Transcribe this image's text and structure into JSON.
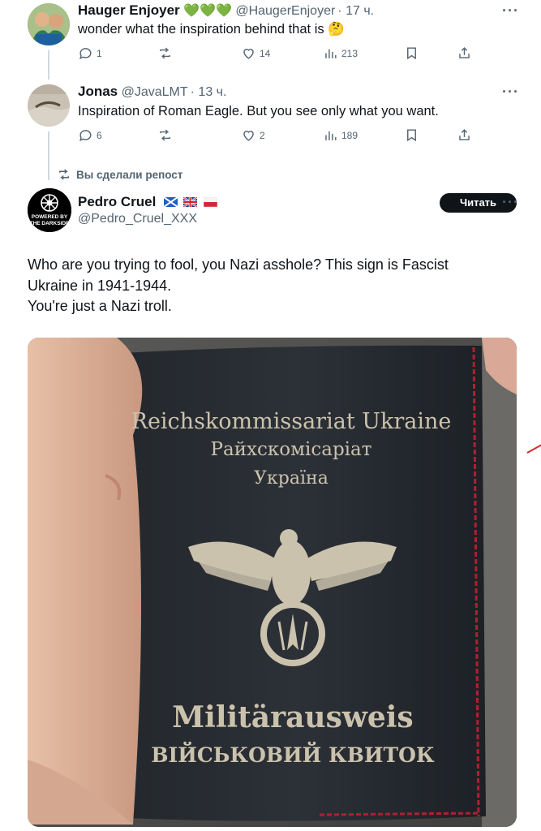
{
  "tweets": [
    {
      "name": "Hauger Enjoyer",
      "badges": "💚💚💚",
      "handle": "@HaugerEnjoyer",
      "time": "· 17 ч.",
      "text": "wonder what the inspiration behind that is 🤔",
      "replies": "1",
      "retweets": "",
      "likes": "14",
      "views": "213"
    },
    {
      "name": "Jonas",
      "handle": "@JavaLMT",
      "time": "· 13 ч.",
      "text": "Inspiration of Roman Eagle. But you see only what you want.",
      "replies": "6",
      "retweets": "",
      "likes": "2",
      "views": "189"
    }
  ],
  "repost_label": "Вы сделали репост",
  "main_tweet": {
    "name": "Pedro Cruel",
    "handle": "@Pedro_Cruel_XXX",
    "follow_label": "Читать",
    "avatar_text": [
      "POWERED BY",
      "THE DARKSIDE"
    ],
    "text_line1": "Who are you trying to fool, you Nazi asshole? This sign is Fascist",
    "text_line2": "Ukraine in 1941-1944.",
    "text_line3": "You're just a Nazi troll."
  },
  "photo": {
    "line1": "Reichskommissariat Ukraine",
    "line2": "Райхскомісаріат",
    "line3": "Україна",
    "line4": "Militärausweis",
    "line5": "ВІЙСЬКОВИЙ КВИТОК"
  },
  "more_icon": "···"
}
